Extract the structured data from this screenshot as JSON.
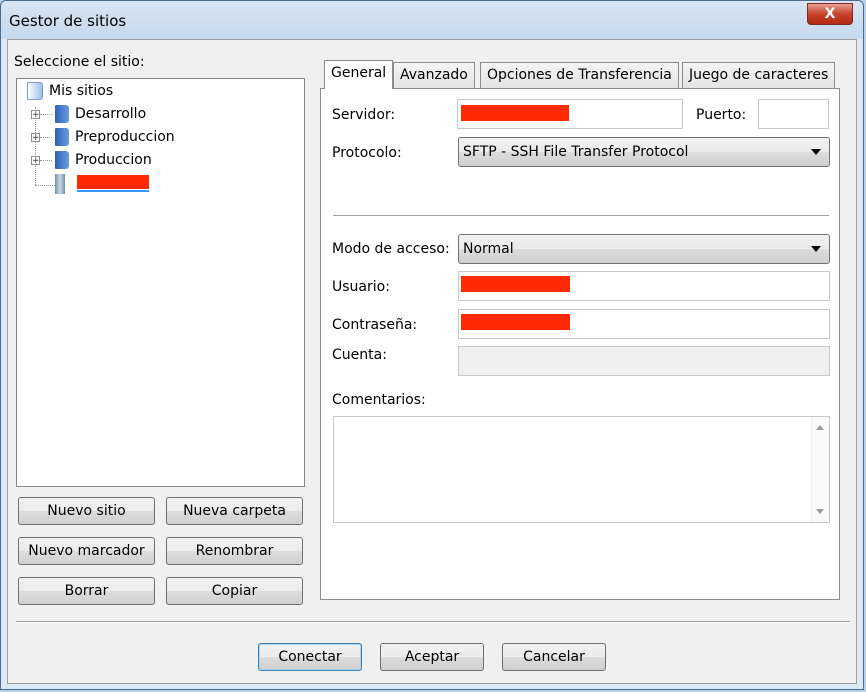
{
  "window": {
    "title": "Gestor de sitios",
    "close_label": "X"
  },
  "left": {
    "select_label": "Seleccione el sitio:",
    "tree": {
      "root": "Mis sitios",
      "items": [
        "Desarrollo",
        "Preproduccion",
        "Produccion"
      ]
    },
    "buttons": {
      "new_site": "Nuevo sitio",
      "new_folder": "Nueva carpeta",
      "new_bookmark": "Nuevo marcador",
      "rename": "Renombrar",
      "delete": "Borrar",
      "copy": "Copiar"
    }
  },
  "tabs": [
    "General",
    "Avanzado",
    "Opciones de Transferencia",
    "Juego de caracteres"
  ],
  "general": {
    "server_label": "Servidor:",
    "port_label": "Puerto:",
    "port_value": "",
    "protocol_label": "Protocolo:",
    "protocol_value": "SFTP - SSH File Transfer Protocol",
    "access_mode_label": "Modo de acceso:",
    "access_mode_value": "Normal",
    "user_label": "Usuario:",
    "password_label": "Contraseña:",
    "account_label": "Cuenta:",
    "comments_label": "Comentarios:",
    "comments_value": ""
  },
  "footer": {
    "connect": "Conectar",
    "accept": "Aceptar",
    "cancel": "Cancelar"
  },
  "colors": {
    "redaction": "#ff2a00",
    "selection": "#3399ff"
  }
}
